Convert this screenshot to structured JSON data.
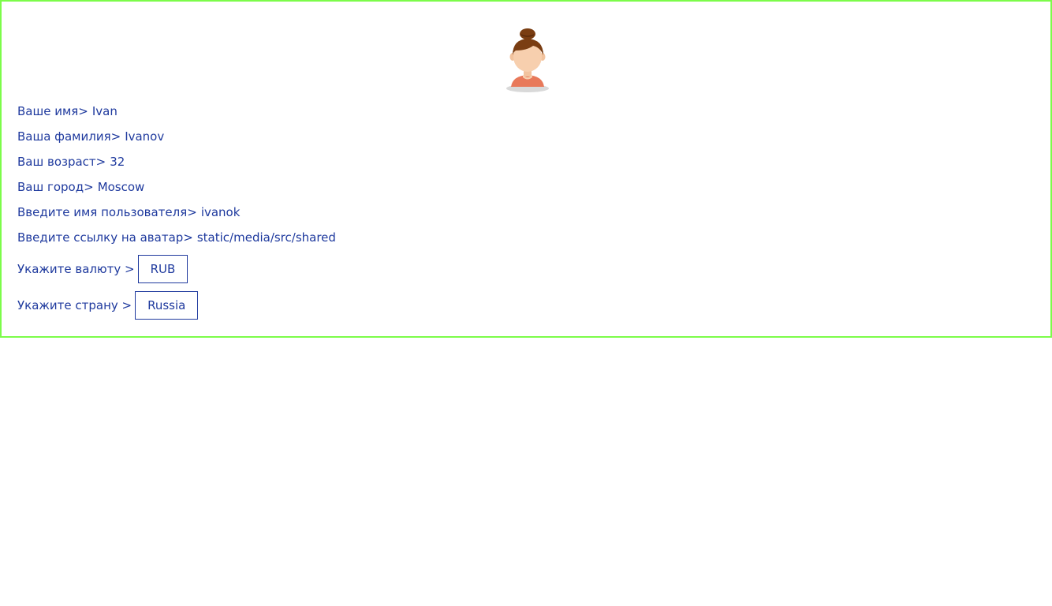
{
  "avatar": {
    "icon": "woman-avatar-icon",
    "colors": {
      "hair": "#7a3d12",
      "skin": "#f7cfae",
      "shirt": "#e8795a",
      "shadow": "#d9d9d9"
    }
  },
  "profile": {
    "first_name": {
      "label": "Ваше имя>",
      "value": "Ivan"
    },
    "last_name": {
      "label": "Ваша фамилия>",
      "value": "Ivanov"
    },
    "age": {
      "label": "Ваш возраст>",
      "value": "32"
    },
    "city": {
      "label": "Ваш город>",
      "value": "Moscow"
    },
    "username": {
      "label": "Введите имя пользователя>",
      "value": "ivanok"
    },
    "avatar_link": {
      "label": "Введите ссылку на аватар>",
      "value": "static/media/src/shared"
    },
    "currency": {
      "label": "Укажите валюту >",
      "value": "RUB"
    },
    "country": {
      "label": "Укажите страну >",
      "value": "Russia"
    }
  },
  "colors": {
    "border": "#7cfc4a",
    "text": "#1f3a9e"
  }
}
